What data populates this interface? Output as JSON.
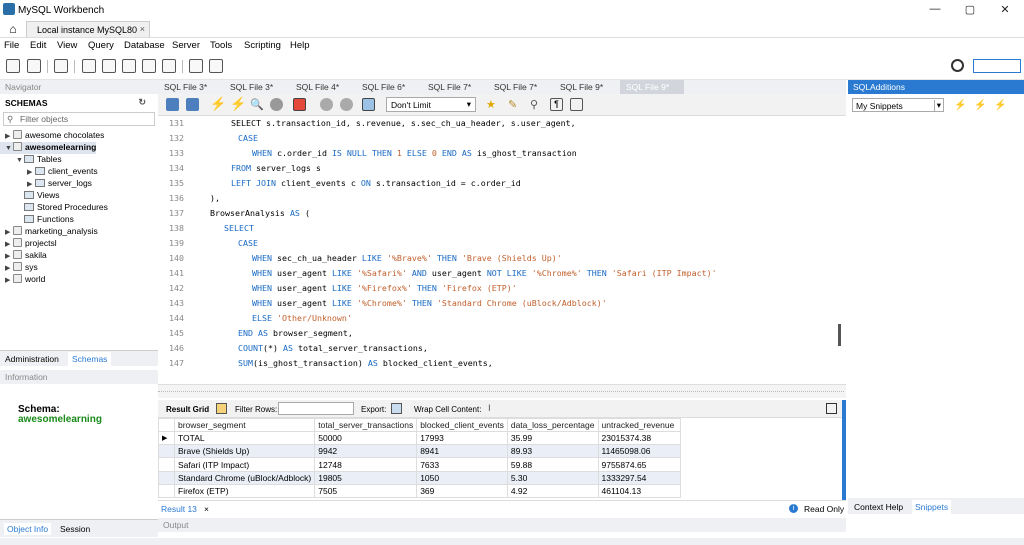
{
  "window": {
    "title": "MySQL Workbench",
    "buttons": [
      "—",
      "▢",
      "✕"
    ]
  },
  "connection_tab": {
    "label": "Local instance MySQL80",
    "close": "×"
  },
  "menu": [
    "File",
    "Edit",
    "View",
    "Query",
    "Database",
    "Server",
    "Tools",
    "Scripting",
    "Help"
  ],
  "navigator": {
    "header": "Navigator",
    "schemas_title": "SCHEMAS",
    "filter_placeholder": "Filter objects",
    "tree": [
      {
        "label": "awesome chocolates",
        "level": 0,
        "expanded": false,
        "type": "db"
      },
      {
        "label": "awesomelearning",
        "level": 0,
        "expanded": true,
        "type": "db",
        "bold": true
      },
      {
        "label": "Tables",
        "level": 1,
        "expanded": true,
        "type": "folder"
      },
      {
        "label": "client_events",
        "level": 2,
        "expanded": false,
        "type": "table"
      },
      {
        "label": "server_logs",
        "level": 2,
        "expanded": false,
        "type": "table"
      },
      {
        "label": "Views",
        "level": 1,
        "type": "folder"
      },
      {
        "label": "Stored Procedures",
        "level": 1,
        "type": "folder"
      },
      {
        "label": "Functions",
        "level": 1,
        "type": "folder"
      },
      {
        "label": "marketing_analysis",
        "level": 0,
        "expanded": false,
        "type": "db"
      },
      {
        "label": "projectsl",
        "level": 0,
        "expanded": false,
        "type": "db"
      },
      {
        "label": "sakila",
        "level": 0,
        "expanded": false,
        "type": "db"
      },
      {
        "label": "sys",
        "level": 0,
        "expanded": false,
        "type": "db"
      },
      {
        "label": "world",
        "level": 0,
        "expanded": false,
        "type": "db"
      }
    ],
    "tabs": [
      "Administration",
      "Schemas"
    ],
    "info_header": "Information",
    "schema_label": "Schema:",
    "schema_value": "awesomelearning",
    "bottom_tabs": [
      "Object Info",
      "Session"
    ]
  },
  "sql_tabs": [
    "SQL File 3*",
    "SQL File 3*",
    "SQL File 4*",
    "SQL File 6*",
    "SQL File 7*",
    "SQL File 7*",
    "SQL File 9*",
    "SQL File 9*"
  ],
  "editor": {
    "limit": "Don't Limit",
    "lines": [
      {
        "n": "131",
        "code": [
          [
            "",
            "SELECT s.transaction_id, s.revenue, s.sec_ch_ua_header, s.user_agent,"
          ]
        ],
        "indent": 3
      },
      {
        "n": "132",
        "code": [
          [
            "kw",
            "CASE"
          ]
        ],
        "indent": 4
      },
      {
        "n": "133",
        "code": [
          [
            "kw",
            "WHEN "
          ],
          [
            "",
            "c.order_id "
          ],
          [
            "kw",
            "IS NULL THEN "
          ],
          [
            "num",
            "1 "
          ],
          [
            "kw",
            "ELSE "
          ],
          [
            "num",
            "0 "
          ],
          [
            "kw",
            "END AS "
          ],
          [
            "",
            "is_ghost_transaction"
          ]
        ],
        "indent": 6
      },
      {
        "n": "134",
        "code": [
          [
            "kw",
            "FROM "
          ],
          [
            "",
            "server_logs s"
          ]
        ],
        "indent": 3
      },
      {
        "n": "135",
        "code": [
          [
            "kw",
            "LEFT JOIN "
          ],
          [
            "",
            "client_events c "
          ],
          [
            "kw",
            "ON "
          ],
          [
            "",
            "s.transaction_id = c.order_id"
          ]
        ],
        "indent": 3
      },
      {
        "n": "136",
        "code": [
          [
            "",
            "),"
          ]
        ],
        "indent": 0
      },
      {
        "n": "137",
        "code": [
          [
            "",
            "BrowserAnalysis "
          ],
          [
            "kw",
            "AS "
          ],
          [
            "",
            "("
          ]
        ],
        "indent": 0
      },
      {
        "n": "138",
        "code": [
          [
            "kw",
            "SELECT"
          ]
        ],
        "indent": 2
      },
      {
        "n": "139",
        "code": [
          [
            "kw",
            "CASE"
          ]
        ],
        "indent": 4
      },
      {
        "n": "140",
        "code": [
          [
            "kw",
            "WHEN "
          ],
          [
            "",
            "sec_ch_ua_header "
          ],
          [
            "kw",
            "LIKE "
          ],
          [
            "str",
            "'%Brave%' "
          ],
          [
            "kw",
            "THEN "
          ],
          [
            "str",
            "'Brave (Shields Up)'"
          ]
        ],
        "indent": 6
      },
      {
        "n": "141",
        "code": [
          [
            "kw",
            "WHEN "
          ],
          [
            "",
            "user_agent "
          ],
          [
            "kw",
            "LIKE "
          ],
          [
            "str",
            "'%Safari%' "
          ],
          [
            "kw",
            "AND "
          ],
          [
            "",
            "user_agent "
          ],
          [
            "kw",
            "NOT LIKE "
          ],
          [
            "str",
            "'%Chrome%' "
          ],
          [
            "kw",
            "THEN "
          ],
          [
            "str",
            "'Safari (ITP Impact)'"
          ]
        ],
        "indent": 6
      },
      {
        "n": "142",
        "code": [
          [
            "kw",
            "WHEN "
          ],
          [
            "",
            "user_agent "
          ],
          [
            "kw",
            "LIKE "
          ],
          [
            "str",
            "'%Firefox%' "
          ],
          [
            "kw",
            "THEN "
          ],
          [
            "str",
            "'Firefox (ETP)'"
          ]
        ],
        "indent": 6
      },
      {
        "n": "143",
        "code": [
          [
            "kw",
            "WHEN "
          ],
          [
            "",
            "user_agent "
          ],
          [
            "kw",
            "LIKE "
          ],
          [
            "str",
            "'%Chrome%' "
          ],
          [
            "kw",
            "THEN "
          ],
          [
            "str",
            "'Standard Chrome (uBlock/Adblock)'"
          ]
        ],
        "indent": 6
      },
      {
        "n": "144",
        "code": [
          [
            "kw",
            "ELSE "
          ],
          [
            "str",
            "'Other/Unknown'"
          ]
        ],
        "indent": 6
      },
      {
        "n": "145",
        "code": [
          [
            "kw",
            "END AS "
          ],
          [
            "",
            "browser_segment,"
          ]
        ],
        "indent": 4
      },
      {
        "n": "146",
        "code": [
          [
            "kw",
            "COUNT"
          ],
          [
            "",
            "(*) "
          ],
          [
            "kw",
            "AS "
          ],
          [
            "",
            "total_server_transactions,"
          ]
        ],
        "indent": 4
      },
      {
        "n": "147",
        "code": [
          [
            "kw",
            "SUM"
          ],
          [
            "",
            "(is_ghost_transaction) "
          ],
          [
            "kw",
            "AS "
          ],
          [
            "",
            "blocked_client_events,"
          ]
        ],
        "indent": 4
      }
    ]
  },
  "result": {
    "toolbar": {
      "grid": "Result Grid",
      "filter": "Filter Rows:",
      "export": "Export:",
      "wrap": "Wrap Cell Content:"
    },
    "columns": [
      "browser_segment",
      "total_server_transactions",
      "blocked_client_events",
      "data_loss_percentage",
      "untracked_revenue"
    ],
    "rows": [
      [
        "TOTAL",
        "50000",
        "17993",
        "35.99",
        "23015374.38"
      ],
      [
        "Brave (Shields Up)",
        "9942",
        "8941",
        "89.93",
        "11465098.06"
      ],
      [
        "Safari (ITP Impact)",
        "12748",
        "7633",
        "59.88",
        "9755874.65"
      ],
      [
        "Standard Chrome (uBlock/Adblock)",
        "19805",
        "1050",
        "5.30",
        "1333297.54"
      ],
      [
        "Firefox (ETP)",
        "7505",
        "369",
        "4.92",
        "461104.13"
      ]
    ],
    "tab": "Result 13",
    "tab_close": "×",
    "read_only": "Read Only",
    "output": "Output"
  },
  "right_panel": {
    "header": "SQLAdditions",
    "select": "My Snippets",
    "tabs": [
      "Context Help",
      "Snippets"
    ]
  },
  "colors": {
    "accent": "#2a7ad2",
    "keyword": "#1a6bc4",
    "string": "#c0602d",
    "schema_green": "#1a8a1a"
  }
}
